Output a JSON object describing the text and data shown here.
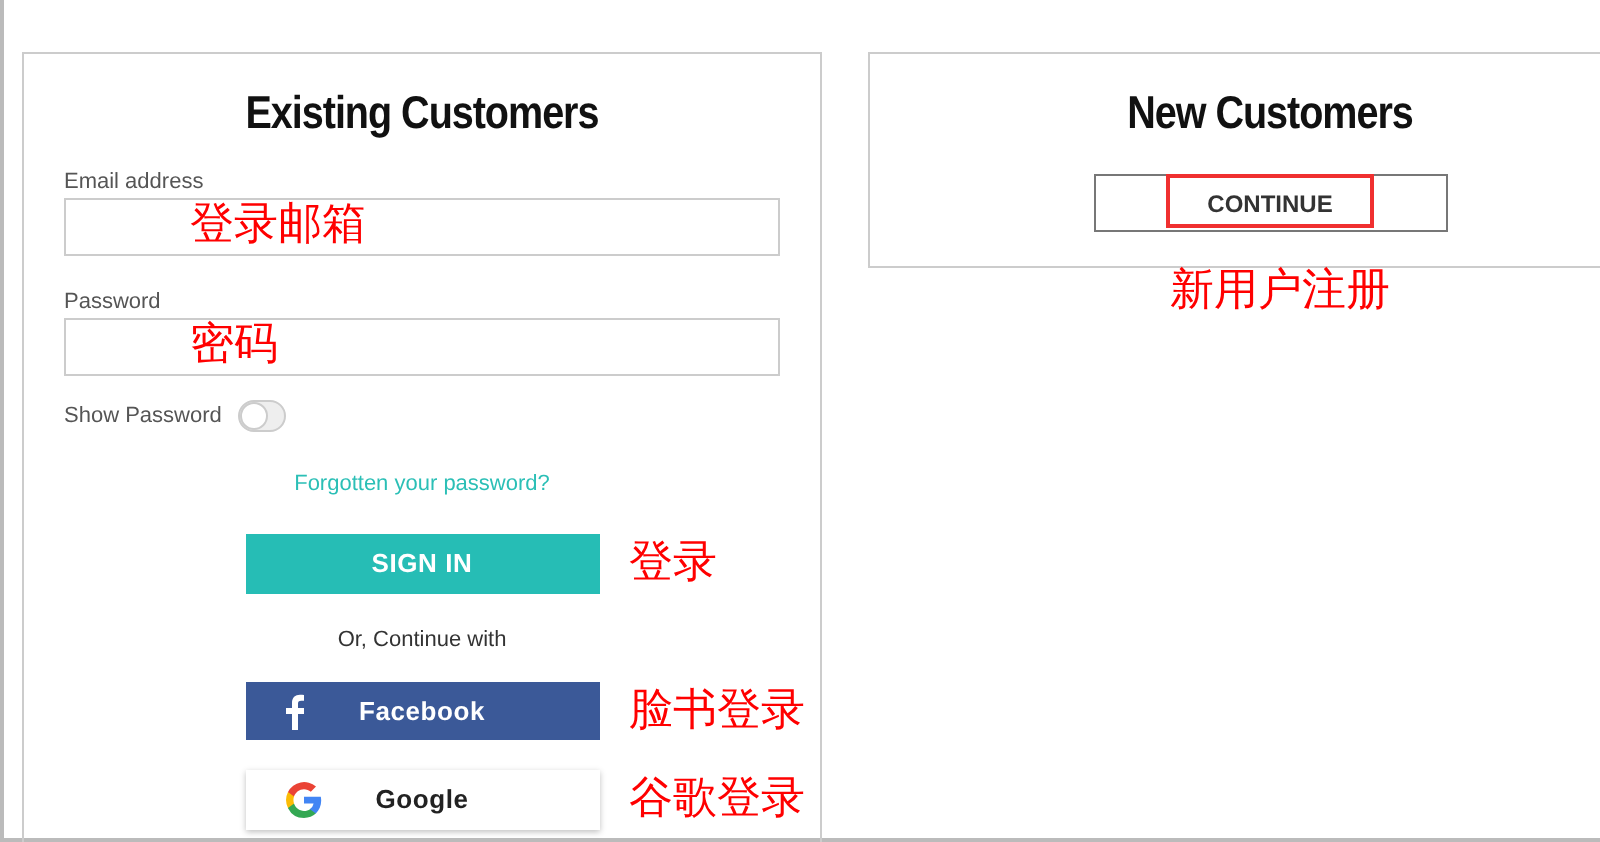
{
  "existing_customers": {
    "title": "Existing Customers",
    "fields": [
      {
        "label": "Email address",
        "annotation": "登录邮箱"
      },
      {
        "label": "Password",
        "annotation": "密码"
      }
    ],
    "show_password": {
      "label": "Show Password",
      "on": false
    },
    "forgot_link": "Forgotten your password?",
    "sign_in": {
      "label": "SIGN IN",
      "annotation": "登录"
    },
    "divider_text": "Or, Continue with",
    "social_buttons": [
      {
        "kind": "facebook",
        "label": "Facebook",
        "annotation": "脸书登录"
      },
      {
        "kind": "google",
        "label": "Google",
        "annotation": "谷歌登录"
      }
    ]
  },
  "new_customers": {
    "title": "New Customers",
    "continue": {
      "label": "CONTINUE",
      "highlighted": true
    },
    "annotation": "新用户注册"
  }
}
